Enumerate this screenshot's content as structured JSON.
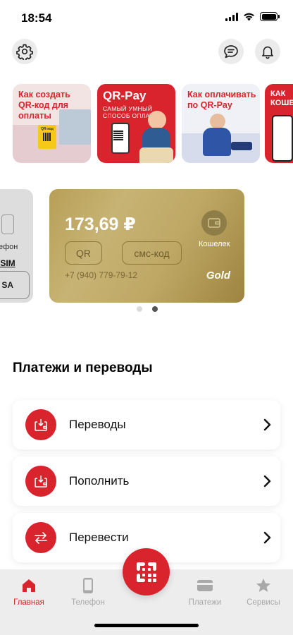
{
  "status_bar": {
    "time": "18:54"
  },
  "stories": [
    {
      "title": "Как создать QR-код для оплаты",
      "badge": "QR-код"
    },
    {
      "title": "QR-Pay",
      "subtitle": "САМЫЙ УМНЫЙ СПОСОБ ОПЛАТЫ"
    },
    {
      "title": "Как оплачивать по QR-Pay"
    },
    {
      "title": "КАК КОШЕЛЕ"
    }
  ],
  "left_card": {
    "label": "ефон",
    "link": "/SIM",
    "button": "SA"
  },
  "card": {
    "balance": "173,69 ₽",
    "qr_button": "QR",
    "sms_button": "смс-код",
    "phone": "+7 (940) 779-79-12",
    "tier": "Gold",
    "wallet_label": "Кошелек"
  },
  "carousel": {
    "pages": 2,
    "active_page": 2
  },
  "payments": {
    "title": "Платежи и переводы",
    "items": [
      {
        "label": "Переводы"
      },
      {
        "label": "Пополнить"
      },
      {
        "label": "Перевести"
      }
    ]
  },
  "tabbar": {
    "items": [
      {
        "label": "Главная",
        "icon": "home-icon",
        "active": true
      },
      {
        "label": "Телефон",
        "icon": "phone-icon",
        "active": false
      },
      {
        "label": "Платежи",
        "icon": "card-icon",
        "active": false
      },
      {
        "label": "Сервисы",
        "icon": "star-icon",
        "active": false
      }
    ],
    "center_icon": "qr-icon"
  },
  "colors": {
    "accent": "#d9232d",
    "gold": "#bfa866",
    "tab_inactive": "#a8a8a8",
    "tab_background": "#ededed"
  }
}
